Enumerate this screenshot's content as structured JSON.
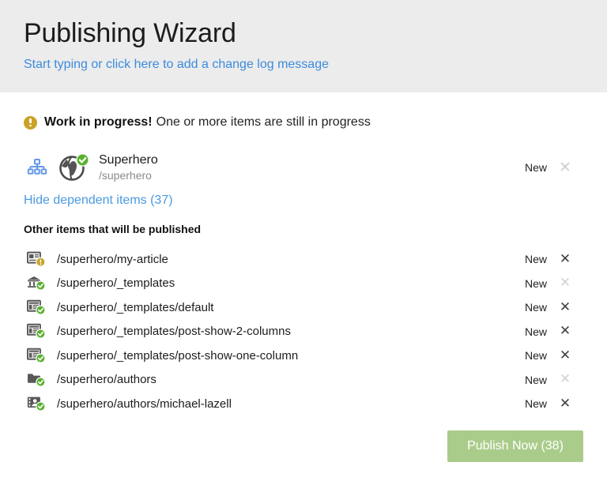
{
  "header": {
    "title": "Publishing Wizard",
    "changelog_link": "Start typing or click here to add a change log message",
    "background": "#ececec",
    "link_color": "#3b8bdd"
  },
  "warning": {
    "icon": "warning-badge-icon",
    "strong": "Work in progress!",
    "message": " One or more items are still in progress",
    "color": "#c9a227"
  },
  "root_item": {
    "sitemap_icon": "sitemap-icon",
    "status_icon": "globe-published-icon",
    "name": "Superhero",
    "path": "/superhero",
    "status": "New",
    "remove_label": "✕",
    "remove_enabled": false
  },
  "toggle": {
    "label": "Hide dependent items (37)",
    "count": 37,
    "color": "#4a9ae0"
  },
  "dependents": {
    "section_title": "Other items that will be published",
    "items": [
      {
        "icon": "page-icon",
        "badge": "warning-badge",
        "path": "/superhero/my-article",
        "status": "New",
        "remove_label": "✕",
        "remove_enabled": true
      },
      {
        "icon": "bank-icon",
        "badge": "check-badge",
        "path": "/superhero/_templates",
        "status": "New",
        "remove_label": "✕",
        "remove_enabled": false
      },
      {
        "icon": "template-icon",
        "badge": "check-badge",
        "path": "/superhero/_templates/default",
        "status": "New",
        "remove_label": "✕",
        "remove_enabled": true
      },
      {
        "icon": "template-icon",
        "badge": "check-badge",
        "path": "/superhero/_templates/post-show-2-columns",
        "status": "New",
        "remove_label": "✕",
        "remove_enabled": true
      },
      {
        "icon": "template-icon",
        "badge": "check-badge",
        "path": "/superhero/_templates/post-show-one-column",
        "status": "New",
        "remove_label": "✕",
        "remove_enabled": true
      },
      {
        "icon": "folder-icon",
        "badge": "check-badge",
        "path": "/superhero/authors",
        "status": "New",
        "remove_label": "✕",
        "remove_enabled": false
      },
      {
        "icon": "contact-card-icon",
        "badge": "check-badge",
        "path": "/superhero/authors/michael-lazell",
        "status": "New",
        "remove_label": "✕",
        "remove_enabled": true
      }
    ]
  },
  "footer": {
    "publish_label": "Publish Now (38)",
    "publish_count": 38,
    "button_color": "#aacc8b"
  },
  "colors": {
    "check_green": "#5bb12f",
    "warning_gold": "#c9a227",
    "icon_gray": "#585858",
    "sitemap_blue": "#6699e8"
  }
}
